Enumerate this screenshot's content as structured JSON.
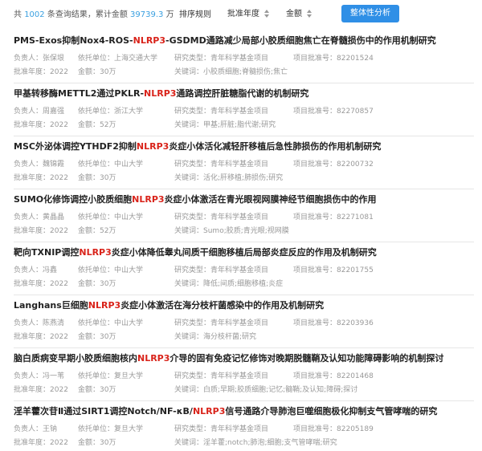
{
  "summary": {
    "prefix": "共",
    "count": "1002",
    "mid": "条查询结果，累计金额",
    "amount": "39739.3",
    "suffix": "万"
  },
  "sort": {
    "label": "排序规则",
    "year_label": "批准年度",
    "amount_label": "金额"
  },
  "analyze_button": "整体性分析",
  "labels": {
    "leader": "负责人：",
    "unit": "依托单位：",
    "type": "研究类型：",
    "approval_no": "项目批准号：",
    "year": "批准年度：",
    "amount": "金额：",
    "keywords": "关键词："
  },
  "results": [
    {
      "title_before": "PMS-Exos抑制Nox4-ROS-",
      "title_hl": "NLRP3",
      "title_after": "-GSDMD通路减少局部小胶质细胞焦亡在脊髓损伤中的作用机制研究",
      "leader": "张保垠",
      "unit": "上海交通大学",
      "type": "青年科学基金项目",
      "approval_no": "82201524",
      "year": "2022",
      "amount": "30万",
      "keywords": "小胶质细胞;脊髓损伤;焦亡"
    },
    {
      "title_before": "甲基转移酶METTL2通过PKLR-",
      "title_hl": "NLRP3",
      "title_after": "通路调控肝脏糖脂代谢的机制研究",
      "leader": "周嘉强",
      "unit": "浙江大学",
      "type": "青年科学基金项目",
      "approval_no": "82270857",
      "year": "2022",
      "amount": "52万",
      "keywords": "甲基;肝脏;脂代谢;研究"
    },
    {
      "title_before": "MSC外泌体调控YTHDF2抑制",
      "title_hl": "NLRP3",
      "title_after": "炎症小体活化减轻肝移植后急性肺损伤的作用机制研究",
      "leader": "魏锦霞",
      "unit": "中山大学",
      "type": "青年科学基金项目",
      "approval_no": "82200732",
      "year": "2022",
      "amount": "30万",
      "keywords": "活化;肝移植;肺损伤;研究"
    },
    {
      "title_before": "SUMO化修饰调控小胶质细胞",
      "title_hl": "NLRP3",
      "title_after": "炎症小体激活在青光眼视网膜神经节细胞损伤中的作用",
      "leader": "黄晶晶",
      "unit": "中山大学",
      "type": "青年科学基金项目",
      "approval_no": "82271081",
      "year": "2022",
      "amount": "52万",
      "keywords": "Sumo;胶质;青光眼;视网膜"
    },
    {
      "title_before": "靶向TXNIP调控",
      "title_hl": "NLRP3",
      "title_after": "炎症小体降低睾丸间质干细胞移植后局部炎症反应的作用及机制研究",
      "leader": "冯鑫",
      "unit": "中山大学",
      "type": "青年科学基金项目",
      "approval_no": "82201755",
      "year": "2022",
      "amount": "30万",
      "keywords": "降低;间质;细胞移植;炎症"
    },
    {
      "title_before": "Langhans巨细胞",
      "title_hl": "NLRP3",
      "title_after": "炎症小体激活在海分枝杆菌感染中的作用及机制研究",
      "leader": "陈燕清",
      "unit": "中山大学",
      "type": "青年科学基金项目",
      "approval_no": "82203936",
      "year": "2022",
      "amount": "30万",
      "keywords": "海分枝杆菌;研究"
    },
    {
      "title_before": "脑白质病变早期小胶质细胞核内",
      "title_hl": "NLRP3",
      "title_after": "介导的固有免疫记忆修饰对晚期脱髓鞘及认知功能障碍影响的机制探讨",
      "leader": "冯一苇",
      "unit": "复旦大学",
      "type": "青年科学基金项目",
      "approval_no": "82201468",
      "year": "2022",
      "amount": "30万",
      "keywords": "白质;早期;胶质细胞;记忆;髓鞘;及认知;障碍;探讨"
    },
    {
      "title_before": "淫羊藿次苷Ⅱ通过SIRT1调控Notch/NF-κB/",
      "title_hl": "NLRP3",
      "title_after": "信号通路介导肺泡巨噬细胞极化抑制支气管哮喘的研究",
      "leader": "王钠",
      "unit": "复旦大学",
      "type": "青年科学基金项目",
      "approval_no": "82205189",
      "year": "2022",
      "amount": "30万",
      "keywords": "淫羊藿;notch;肺泡;细胞;支气管哮喘;研究"
    }
  ]
}
